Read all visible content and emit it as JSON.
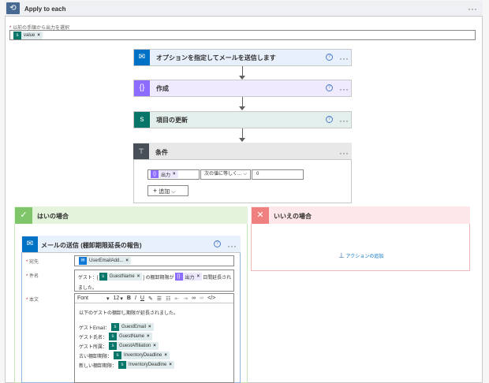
{
  "apply": {
    "title": "Apply to each",
    "field_label": "以前の手順から出力を選択",
    "token": "value"
  },
  "steps": [
    {
      "title": "オプションを指定してメールを送信します",
      "color": "#0072c6"
    },
    {
      "title": "作成",
      "color": "#8c6cff"
    },
    {
      "title": "項目の更新",
      "color": "#077568"
    }
  ],
  "condition": {
    "title": "条件",
    "left_token": "出力",
    "operator": "次の値に等しく...",
    "right_value": "0",
    "add_label": "追加"
  },
  "yes_branch": {
    "title": "はいの場合",
    "color": "#e6f4e1"
  },
  "no_branch": {
    "title": "いいえの場合",
    "add_action": "アクションの追加"
  },
  "mail": {
    "title": "メールの送信 (棚卸期限延長の報告)",
    "to_label": "宛先",
    "to_token": "UserEmailAdd...",
    "subject_label": "件名",
    "subject_prefix": "ゲスト：[",
    "subject_token1": "GuestName",
    "subject_mid": "] の棚卸期限が",
    "subject_token2": "出力",
    "subject_suffix": "日間延長され",
    "subject_line2": "ました。",
    "body_label": "本文",
    "toolbar": {
      "font": "Font",
      "size": "12"
    },
    "body_intro": "以下のゲストの棚卸し期限が延長されました。",
    "rows": [
      {
        "label": "ゲストEmail：",
        "token": "GuestEmail"
      },
      {
        "label": "ゲスト氏名：",
        "token": "GuestName"
      },
      {
        "label": "ゲスト所属：",
        "token": "GuestAffiliation"
      },
      {
        "label": "古い棚卸期限：",
        "token": "InventoryDeadline"
      },
      {
        "label": "新しい棚卸期限：",
        "token": "InventoryDeadline"
      }
    ]
  }
}
